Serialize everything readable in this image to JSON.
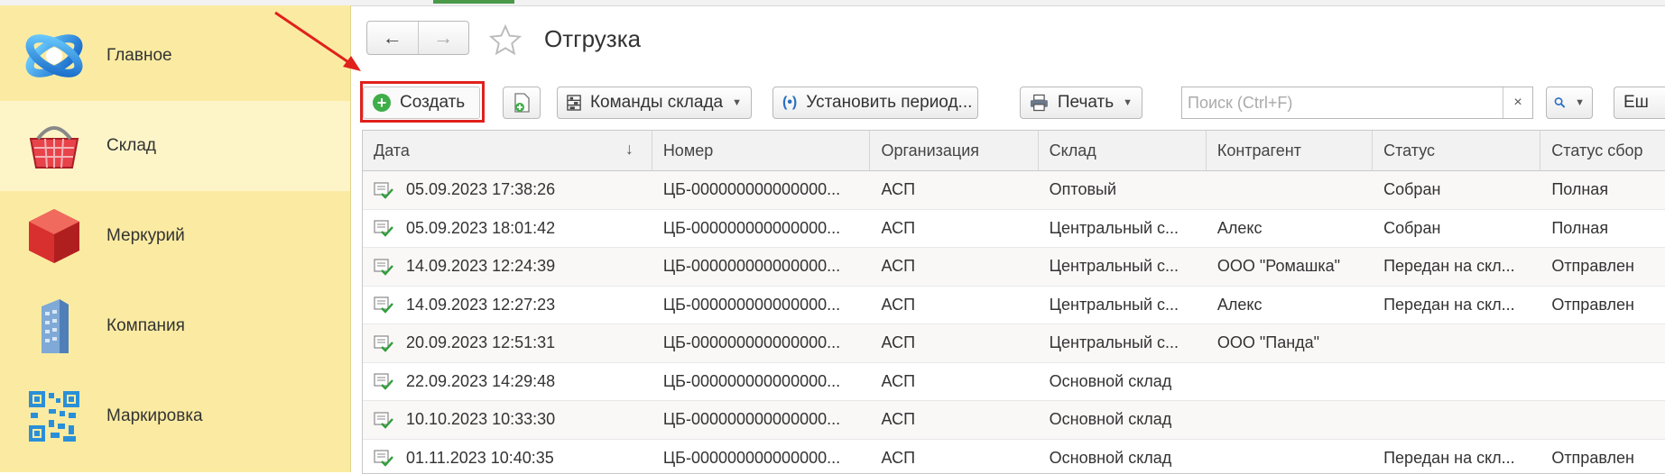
{
  "sidebar": {
    "items": [
      {
        "label": "Главное",
        "icon": "globe-logo-icon"
      },
      {
        "label": "Склад",
        "icon": "basket-icon"
      },
      {
        "label": "Меркурий",
        "icon": "red-cube-icon"
      },
      {
        "label": "Компания",
        "icon": "building-icon"
      },
      {
        "label": "Маркировка",
        "icon": "qr-code-icon"
      }
    ]
  },
  "header": {
    "title": "Отгрузка",
    "back": "←",
    "forward": "→"
  },
  "toolbar": {
    "create_label": "Создать",
    "warehouse_commands_label": "Команды склада",
    "set_period_label": "Установить период...",
    "print_label": "Печать",
    "search_placeholder": "Поиск (Ctrl+F)",
    "search_clear": "×",
    "more_label": "Еш"
  },
  "table": {
    "columns": [
      "Дата",
      "Номер",
      "Организация",
      "Склад",
      "Контрагент",
      "Статус",
      "Статус сбор"
    ],
    "sort_indicator": "↓",
    "rows": [
      {
        "date": "05.09.2023 17:38:26",
        "number": "ЦБ-000000000000000...",
        "org": "АСП",
        "warehouse": "Оптовый",
        "counterparty": "",
        "status": "Собран",
        "assembly": "Полная"
      },
      {
        "date": "05.09.2023 18:01:42",
        "number": "ЦБ-000000000000000...",
        "org": "АСП",
        "warehouse": "Центральный с...",
        "counterparty": "Алекс",
        "status": "Собран",
        "assembly": "Полная"
      },
      {
        "date": "14.09.2023 12:24:39",
        "number": "ЦБ-000000000000000...",
        "org": "АСП",
        "warehouse": "Центральный с...",
        "counterparty": "ООО \"Ромашка\"",
        "status": "Передан на скл...",
        "assembly": "Отправлен"
      },
      {
        "date": "14.09.2023 12:27:23",
        "number": "ЦБ-000000000000000...",
        "org": "АСП",
        "warehouse": "Центральный с...",
        "counterparty": "Алекс",
        "status": "Передан на скл...",
        "assembly": "Отправлен"
      },
      {
        "date": "20.09.2023 12:51:31",
        "number": "ЦБ-000000000000000...",
        "org": "АСП",
        "warehouse": "Центральный с...",
        "counterparty": "ООО \"Панда\"",
        "status": "",
        "assembly": ""
      },
      {
        "date": "22.09.2023 14:29:48",
        "number": "ЦБ-000000000000000...",
        "org": "АСП",
        "warehouse": "Основной склад",
        "counterparty": "",
        "status": "",
        "assembly": ""
      },
      {
        "date": "10.10.2023 10:33:30",
        "number": "ЦБ-000000000000000...",
        "org": "АСП",
        "warehouse": "Основной склад",
        "counterparty": "",
        "status": "",
        "assembly": ""
      },
      {
        "date": "01.11.2023 10:40:35",
        "number": "ЦБ-000000000000000...",
        "org": "АСП",
        "warehouse": "Основной склад",
        "counterparty": "",
        "status": "Передан на скл...",
        "assembly": "Отправлен"
      }
    ]
  },
  "colors": {
    "sidebar_bg": "#fbeba2",
    "highlight_red": "#e0211c",
    "create_green": "#3fae49"
  }
}
